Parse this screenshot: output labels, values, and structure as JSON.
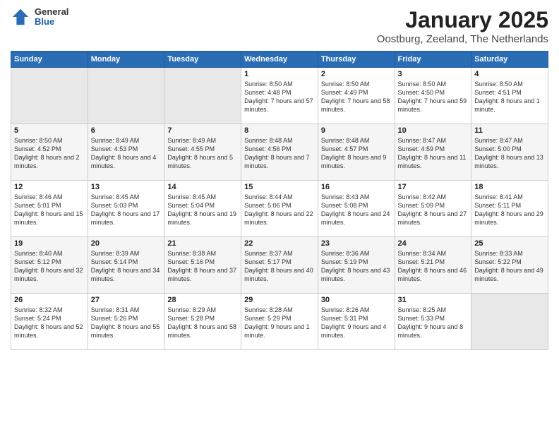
{
  "header": {
    "logo": {
      "general": "General",
      "blue": "Blue"
    },
    "title": "January 2025",
    "location": "Oostburg, Zeeland, The Netherlands"
  },
  "weekdays": [
    "Sunday",
    "Monday",
    "Tuesday",
    "Wednesday",
    "Thursday",
    "Friday",
    "Saturday"
  ],
  "weeks": [
    [
      {
        "day": "",
        "empty": true
      },
      {
        "day": "",
        "empty": true
      },
      {
        "day": "",
        "empty": true
      },
      {
        "day": "1",
        "sunrise": "8:50 AM",
        "sunset": "4:48 PM",
        "daylight": "7 hours and 57 minutes."
      },
      {
        "day": "2",
        "sunrise": "8:50 AM",
        "sunset": "4:49 PM",
        "daylight": "7 hours and 58 minutes."
      },
      {
        "day": "3",
        "sunrise": "8:50 AM",
        "sunset": "4:50 PM",
        "daylight": "7 hours and 59 minutes."
      },
      {
        "day": "4",
        "sunrise": "8:50 AM",
        "sunset": "4:51 PM",
        "daylight": "8 hours and 1 minute."
      }
    ],
    [
      {
        "day": "5",
        "sunrise": "8:50 AM",
        "sunset": "4:52 PM",
        "daylight": "8 hours and 2 minutes."
      },
      {
        "day": "6",
        "sunrise": "8:49 AM",
        "sunset": "4:53 PM",
        "daylight": "8 hours and 4 minutes."
      },
      {
        "day": "7",
        "sunrise": "8:49 AM",
        "sunset": "4:55 PM",
        "daylight": "8 hours and 5 minutes."
      },
      {
        "day": "8",
        "sunrise": "8:48 AM",
        "sunset": "4:56 PM",
        "daylight": "8 hours and 7 minutes."
      },
      {
        "day": "9",
        "sunrise": "8:48 AM",
        "sunset": "4:57 PM",
        "daylight": "8 hours and 9 minutes."
      },
      {
        "day": "10",
        "sunrise": "8:47 AM",
        "sunset": "4:59 PM",
        "daylight": "8 hours and 11 minutes."
      },
      {
        "day": "11",
        "sunrise": "8:47 AM",
        "sunset": "5:00 PM",
        "daylight": "8 hours and 13 minutes."
      }
    ],
    [
      {
        "day": "12",
        "sunrise": "8:46 AM",
        "sunset": "5:01 PM",
        "daylight": "8 hours and 15 minutes."
      },
      {
        "day": "13",
        "sunrise": "8:45 AM",
        "sunset": "5:03 PM",
        "daylight": "8 hours and 17 minutes."
      },
      {
        "day": "14",
        "sunrise": "8:45 AM",
        "sunset": "5:04 PM",
        "daylight": "8 hours and 19 minutes."
      },
      {
        "day": "15",
        "sunrise": "8:44 AM",
        "sunset": "5:06 PM",
        "daylight": "8 hours and 22 minutes."
      },
      {
        "day": "16",
        "sunrise": "8:43 AM",
        "sunset": "5:08 PM",
        "daylight": "8 hours and 24 minutes."
      },
      {
        "day": "17",
        "sunrise": "8:42 AM",
        "sunset": "5:09 PM",
        "daylight": "8 hours and 27 minutes."
      },
      {
        "day": "18",
        "sunrise": "8:41 AM",
        "sunset": "5:11 PM",
        "daylight": "8 hours and 29 minutes."
      }
    ],
    [
      {
        "day": "19",
        "sunrise": "8:40 AM",
        "sunset": "5:12 PM",
        "daylight": "8 hours and 32 minutes."
      },
      {
        "day": "20",
        "sunrise": "8:39 AM",
        "sunset": "5:14 PM",
        "daylight": "8 hours and 34 minutes."
      },
      {
        "day": "21",
        "sunrise": "8:38 AM",
        "sunset": "5:16 PM",
        "daylight": "8 hours and 37 minutes."
      },
      {
        "day": "22",
        "sunrise": "8:37 AM",
        "sunset": "5:17 PM",
        "daylight": "8 hours and 40 minutes."
      },
      {
        "day": "23",
        "sunrise": "8:36 AM",
        "sunset": "5:19 PM",
        "daylight": "8 hours and 43 minutes."
      },
      {
        "day": "24",
        "sunrise": "8:34 AM",
        "sunset": "5:21 PM",
        "daylight": "8 hours and 46 minutes."
      },
      {
        "day": "25",
        "sunrise": "8:33 AM",
        "sunset": "5:22 PM",
        "daylight": "8 hours and 49 minutes."
      }
    ],
    [
      {
        "day": "26",
        "sunrise": "8:32 AM",
        "sunset": "5:24 PM",
        "daylight": "8 hours and 52 minutes."
      },
      {
        "day": "27",
        "sunrise": "8:31 AM",
        "sunset": "5:26 PM",
        "daylight": "8 hours and 55 minutes."
      },
      {
        "day": "28",
        "sunrise": "8:29 AM",
        "sunset": "5:28 PM",
        "daylight": "8 hours and 58 minutes."
      },
      {
        "day": "29",
        "sunrise": "8:28 AM",
        "sunset": "5:29 PM",
        "daylight": "9 hours and 1 minute."
      },
      {
        "day": "30",
        "sunrise": "8:26 AM",
        "sunset": "5:31 PM",
        "daylight": "9 hours and 4 minutes."
      },
      {
        "day": "31",
        "sunrise": "8:25 AM",
        "sunset": "5:33 PM",
        "daylight": "9 hours and 8 minutes."
      },
      {
        "day": "",
        "empty": true
      }
    ]
  ]
}
